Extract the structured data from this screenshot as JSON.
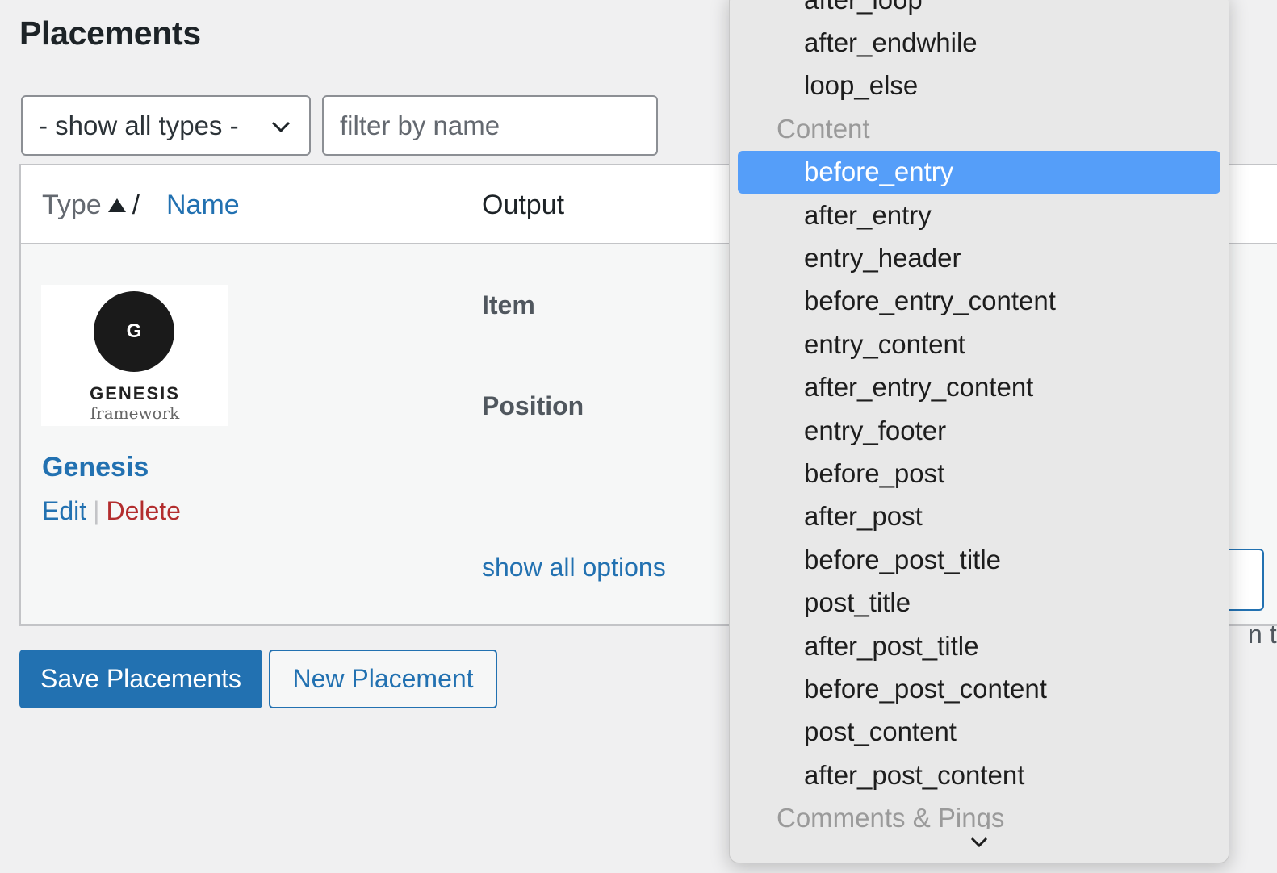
{
  "page": {
    "title": "Placements"
  },
  "filters": {
    "type_select_value": "- show all types -",
    "name_placeholder": "filter by name"
  },
  "table": {
    "header": {
      "type": "Type",
      "separator": "/",
      "name": "Name",
      "output": "Output"
    },
    "row": {
      "logo": {
        "letter": "G",
        "word": "GENESIS",
        "sub": "framework"
      },
      "name": "Genesis",
      "edit": "Edit",
      "separator": "|",
      "delete": "Delete",
      "item_label": "Item",
      "position_label": "Position",
      "show_all_options": "show all options",
      "partial_text": "n th"
    }
  },
  "buttons": {
    "save": "Save Placements",
    "new": "New Placement"
  },
  "dropdown": {
    "rows": [
      {
        "label": "after_loop",
        "kind": "option"
      },
      {
        "label": "after_endwhile",
        "kind": "option"
      },
      {
        "label": "loop_else",
        "kind": "option"
      },
      {
        "label": "Content",
        "kind": "group"
      },
      {
        "label": "before_entry",
        "kind": "option",
        "selected": true
      },
      {
        "label": "after_entry",
        "kind": "option"
      },
      {
        "label": "entry_header",
        "kind": "option"
      },
      {
        "label": "before_entry_content",
        "kind": "option"
      },
      {
        "label": "entry_content",
        "kind": "option"
      },
      {
        "label": "after_entry_content",
        "kind": "option"
      },
      {
        "label": "entry_footer",
        "kind": "option"
      },
      {
        "label": "before_post",
        "kind": "option"
      },
      {
        "label": "after_post",
        "kind": "option"
      },
      {
        "label": "before_post_title",
        "kind": "option"
      },
      {
        "label": "post_title",
        "kind": "option"
      },
      {
        "label": "after_post_title",
        "kind": "option"
      },
      {
        "label": "before_post_content",
        "kind": "option"
      },
      {
        "label": "post_content",
        "kind": "option"
      },
      {
        "label": "after_post_content",
        "kind": "option"
      },
      {
        "label": "Comments & Pings",
        "kind": "group"
      }
    ]
  },
  "colors": {
    "accent": "#2271b1",
    "danger": "#b32d2e",
    "selected": "#559ef9",
    "background": "#f0f0f1"
  }
}
